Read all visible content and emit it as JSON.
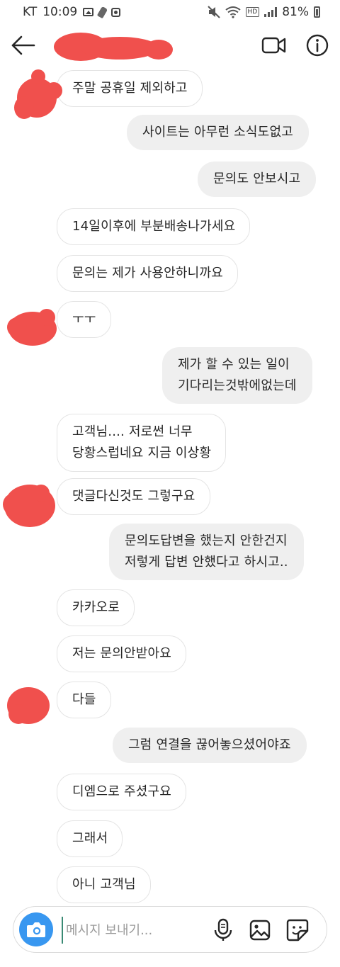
{
  "status_bar": {
    "carrier": "KT",
    "time": "10:09",
    "hd_label": "HD",
    "battery": "81%"
  },
  "header": {
    "contact_name": "",
    "icons": [
      "back-arrow-icon",
      "video-call-icon",
      "info-icon"
    ]
  },
  "messages": [
    {
      "direction": "incoming",
      "text": "주말 공휴일 제외하고"
    },
    {
      "direction": "outgoing",
      "text": "사이트는 아무런 소식도없고"
    },
    {
      "direction": "outgoing",
      "text": "문의도 안보시고"
    },
    {
      "direction": "incoming",
      "text": "14일이후에 부분배송나가세요"
    },
    {
      "direction": "incoming",
      "text": "문의는 제가 사용안하니까요"
    },
    {
      "direction": "incoming",
      "text": "ㅜㅜ"
    },
    {
      "direction": "outgoing",
      "text": "제가 할 수 있는 일이\n기다리는것밖에없는데"
    },
    {
      "direction": "incoming",
      "text": "고객님.... 저로썬 너무\n당황스럽네요 지금 이상황"
    },
    {
      "direction": "incoming",
      "text": "댓글다신것도 그렇구요"
    },
    {
      "direction": "outgoing",
      "text": "문의도답변을 했는지 안한건지\n저렇게 답변 안했다고 하시고.."
    },
    {
      "direction": "incoming",
      "text": "카카오로"
    },
    {
      "direction": "incoming",
      "text": "저는 문의안받아요"
    },
    {
      "direction": "incoming",
      "text": "다들"
    },
    {
      "direction": "outgoing",
      "text": "그럼 연결을 끊어놓으셨어야죠"
    },
    {
      "direction": "incoming",
      "text": "디엠으로 주셨구요"
    },
    {
      "direction": "incoming",
      "text": "그래서"
    },
    {
      "direction": "incoming",
      "text": "아니 고객님"
    }
  ],
  "composer": {
    "placeholder": "메시지 보내기...",
    "value": "",
    "icons": [
      "camera-icon",
      "microphone-icon",
      "gallery-icon",
      "sticker-icon"
    ]
  },
  "colors": {
    "outgoing_bubble": "#efefef",
    "incoming_bubble_border": "#e4e4e4",
    "camera_button": "#3897f0",
    "redaction": "#f0504d"
  }
}
